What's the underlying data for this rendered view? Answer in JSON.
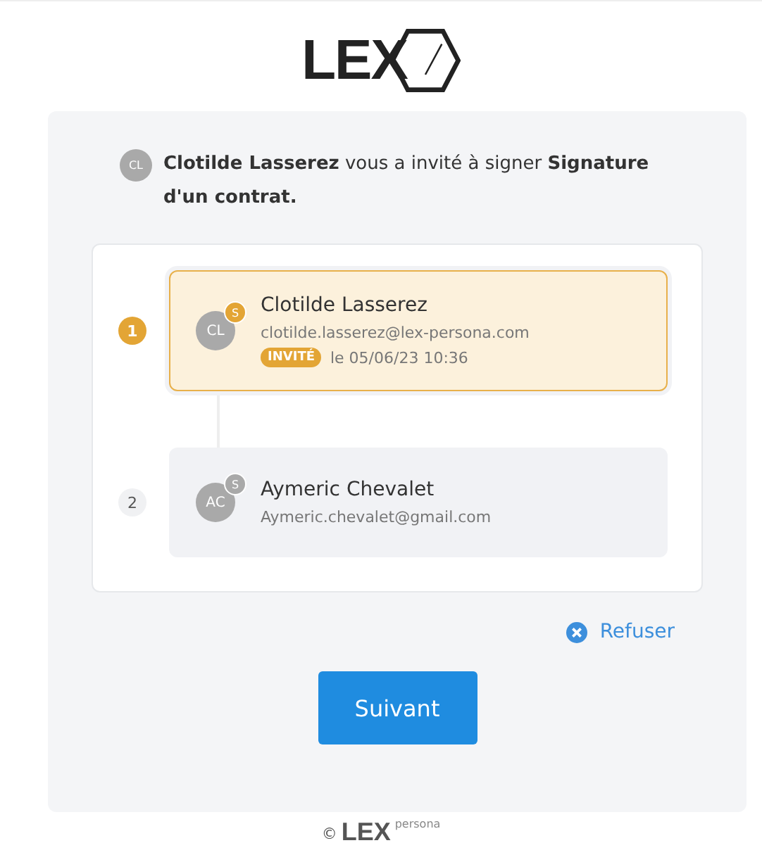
{
  "logo": {
    "text": "LEX"
  },
  "invitation": {
    "avatar": "CL",
    "message": "**Clotilde Lasserez** vous a invité à signer **Signature d'un contrat.**"
  },
  "signers": [
    {
      "number": "1",
      "selected": true,
      "avatar": "CL",
      "role": "S",
      "name": "Clotilde Lasserez",
      "email": "clotilde.lasserez@lex-persona.com",
      "status": "INVITÉ",
      "date": "le 05/06/23 10:36"
    },
    {
      "number": "2",
      "selected": false,
      "avatar": "AC",
      "role": "S",
      "name": "Aymeric Chevalet",
      "email": "Aymeric.chevalet@gmail.com"
    }
  ],
  "refuse_link": "Refuser",
  "next_button": "Suivant",
  "footer": {
    "copyright": "©",
    "brand": "LEX",
    "suffix": "persona"
  }
}
